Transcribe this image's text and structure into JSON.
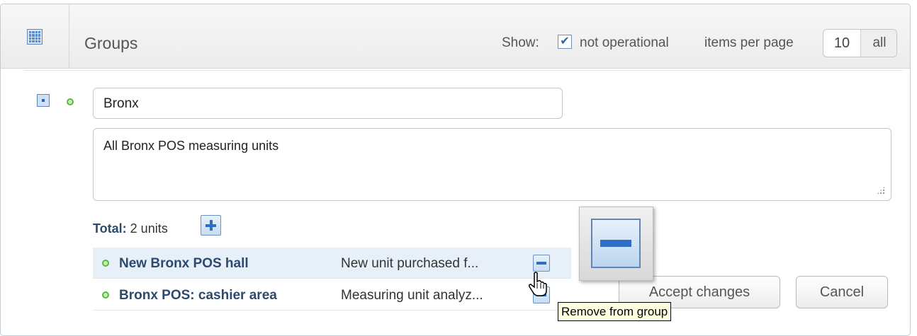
{
  "header": {
    "title": "Groups",
    "show_label": "Show:",
    "not_operational_label": "not operational",
    "not_operational_checked": true,
    "items_per_page_label": "items per page",
    "items_per_page_value": "10",
    "all_label": "all"
  },
  "group": {
    "name": "Bronx",
    "description": "All Bronx POS measuring units",
    "total_label": "Total:",
    "total_value": "2 units",
    "units": [
      {
        "name": "New Bronx POS hall",
        "description": "New unit purchased f..."
      },
      {
        "name": "Bronx POS: cashier area",
        "description": "Measuring unit analyz..."
      }
    ]
  },
  "actions": {
    "accept_label": "Accept changes",
    "cancel_label": "Cancel"
  },
  "tooltip": {
    "text": "Remove from group"
  },
  "icons": {
    "grid": "grid-icon",
    "collapse": "collapse-icon",
    "status": "status-dot-icon",
    "add": "plus-icon",
    "remove": "minus-icon",
    "cursor": "hand-cursor-icon"
  },
  "colors": {
    "accent": "#2e64a8",
    "status_ok": "#5bb83f",
    "row_hover": "#e7f0f9",
    "tooltip_bg": "#ffffe1"
  }
}
